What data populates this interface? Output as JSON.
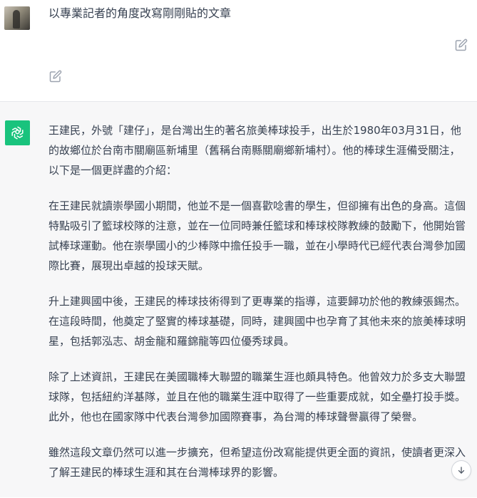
{
  "user_message": {
    "text": "以專業記者的角度改寫剛剛貼的文章"
  },
  "assistant_message": {
    "paragraphs": [
      "王建民，外號「建仔」，是台灣出生的著名旅美棒球投手，出生於1980年03月31日，他的故鄉位於台南市關廟區新埔里（舊稱台南縣關廟鄉新埔村）。他的棒球生涯備受關注，以下是一個更詳盡的介紹：",
      "在王建民就讀崇學國小期間，他並不是一個喜歡唸書的學生，但卻擁有出色的身高。這個特點吸引了籃球校隊的注意，並在一位同時兼任籃球和棒球校隊教練的鼓勵下，他開始嘗試棒球運動。他在崇學國小的少棒隊中擔任投手一職，並在小學時代已經代表台灣參加國際比賽，展現出卓越的投球天賦。",
      "升上建興國中後，王建民的棒球技術得到了更專業的指導，這要歸功於他的教練張錫杰。在這段時間，他奠定了堅實的棒球基礎，同時，建興國中也孕育了其他未來的旅美棒球明星，包括郭泓志、胡金龍和羅錦龍等四位優秀球員。",
      "除了上述資訊，王建民在美國職棒大聯盟的職業生涯也頗具特色。他曾效力於多支大聯盟球隊，包括紐約洋基隊，並且在他的職業生涯中取得了一些重要成就，如全壘打投手獎。此外，他也在國家隊中代表台灣參加國際賽事，為台灣的棒球聲譽贏得了榮譽。",
      "雖然這段文章仍然可以進一步擴充，但希望這份改寫能提供更全面的資訊，使讀者更深入了解王建民的棒球生涯和其在台灣棒球界的影響。"
    ]
  },
  "icons": {
    "user_avatar": "user-photo-avatar",
    "assistant_avatar": "chatgpt-logo-icon",
    "edit_top": "edit-icon",
    "edit_bottom": "edit-icon",
    "scroll": "arrow-down-icon"
  },
  "colors": {
    "assistant_bg": "#f7f7f8",
    "brand_green": "#19c37d",
    "text": "#374151"
  }
}
